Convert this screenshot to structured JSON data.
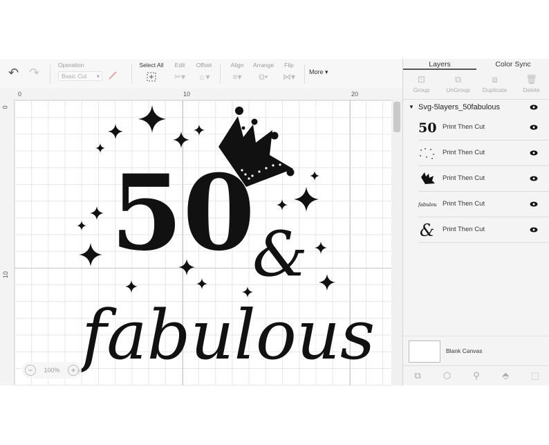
{
  "toolbar": {
    "operation_label": "Operation",
    "operation_value": "Basic Cut",
    "select_all_label": "Select All",
    "edit_label": "Edit",
    "offset_label": "Offset",
    "align_label": "Align",
    "arrange_label": "Arrange",
    "flip_label": "Flip",
    "more_label": "More"
  },
  "ruler": {
    "top_ticks": [
      "0",
      "10",
      "20"
    ],
    "left_ticks": [
      "0",
      "10"
    ]
  },
  "zoom": {
    "level": "100%",
    "minus": "−",
    "plus": "+"
  },
  "design": {
    "number": "50",
    "ampersand": "&",
    "word": "fabulous"
  },
  "panel": {
    "tabs": [
      "Layers",
      "Color Sync"
    ],
    "actions": [
      "Group",
      "UnGroup",
      "Duplicate",
      "Delete"
    ],
    "root_layer": "Svg-5layers_50fabulous",
    "layers": [
      {
        "thumb": "50",
        "name": "Print Then Cut"
      },
      {
        "thumb": "stars",
        "name": "Print Then Cut"
      },
      {
        "thumb": "crown",
        "name": "Print Then Cut"
      },
      {
        "thumb": "fabulous",
        "name": "Print Then Cut"
      },
      {
        "thumb": "&",
        "name": "Print Then Cut"
      }
    ],
    "blank_canvas": "Blank Canvas"
  }
}
